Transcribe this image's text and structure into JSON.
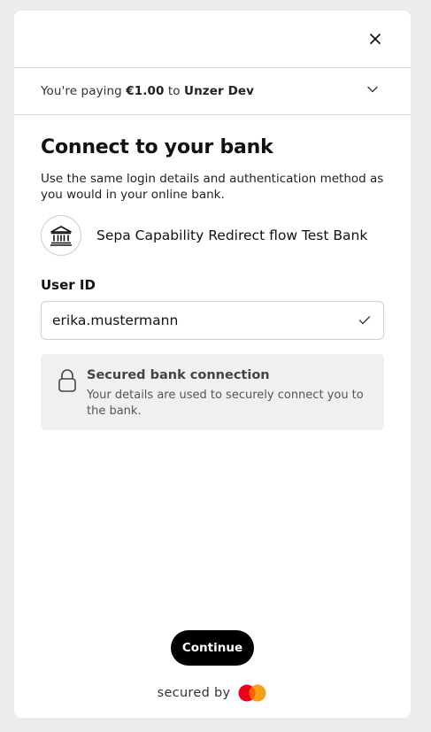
{
  "header": {
    "close_icon": "close-icon"
  },
  "summary": {
    "prefix": "You're paying",
    "amount": "€1.00",
    "connector": "to",
    "merchant": "Unzer Dev",
    "toggle_icon": "chevron-down-icon"
  },
  "main": {
    "title": "Connect to your bank",
    "description": "Use the same login details and authentication method as you would in your online bank.",
    "bank": {
      "icon": "bank-icon",
      "name": "Sepa Capability Redirect flow Test Bank"
    },
    "user_id": {
      "label": "User ID",
      "value": "erika.mustermann",
      "status_icon": "check-icon"
    },
    "secure_notice": {
      "icon": "lock-icon",
      "title": "Secured bank connection",
      "text": "Your details are used to securely connect you to the bank."
    }
  },
  "actions": {
    "continue_label": "Continue"
  },
  "footer": {
    "secured_by": "secured by",
    "brand_icon": "mastercard-logo-icon",
    "colors": {
      "brand_red": "#eb001b",
      "brand_orange": "#f79e1b"
    }
  }
}
